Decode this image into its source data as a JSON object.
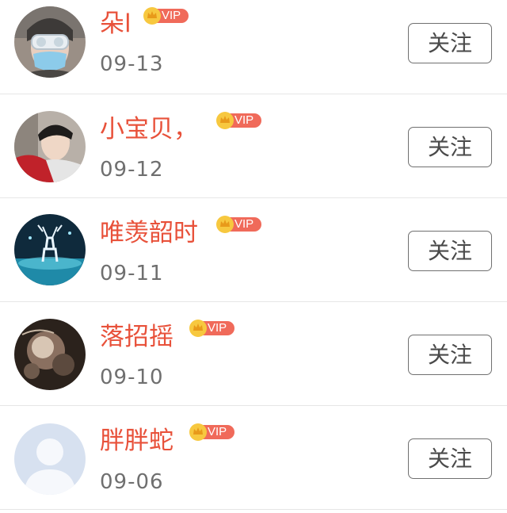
{
  "rows": [
    {
      "name": "朵l",
      "vip": "VIP",
      "date": "09-13",
      "follow": "关注",
      "avatar": "avatar-masked-person"
    },
    {
      "name": "小宝贝，",
      "vip": "VIP",
      "date": "09-12",
      "follow": "关注",
      "avatar": "avatar-young-man"
    },
    {
      "name": "唯羡韶时",
      "vip": "VIP",
      "date": "09-11",
      "follow": "关注",
      "avatar": "avatar-glowing-deer"
    },
    {
      "name": "落招摇",
      "vip": "VIP",
      "date": "09-10",
      "follow": "关注",
      "avatar": "avatar-dark-flowers"
    },
    {
      "name": "胖胖蛇",
      "vip": "VIP",
      "date": "09-06",
      "follow": "关注",
      "avatar": "avatar-default-silhouette"
    }
  ],
  "colors": {
    "name": "#e8513a",
    "vip_badge": "#f06a5a",
    "crown": "#f5c33b",
    "date": "#6f6f6f",
    "follow_border": "#707070",
    "divider": "#e6e6e6"
  }
}
